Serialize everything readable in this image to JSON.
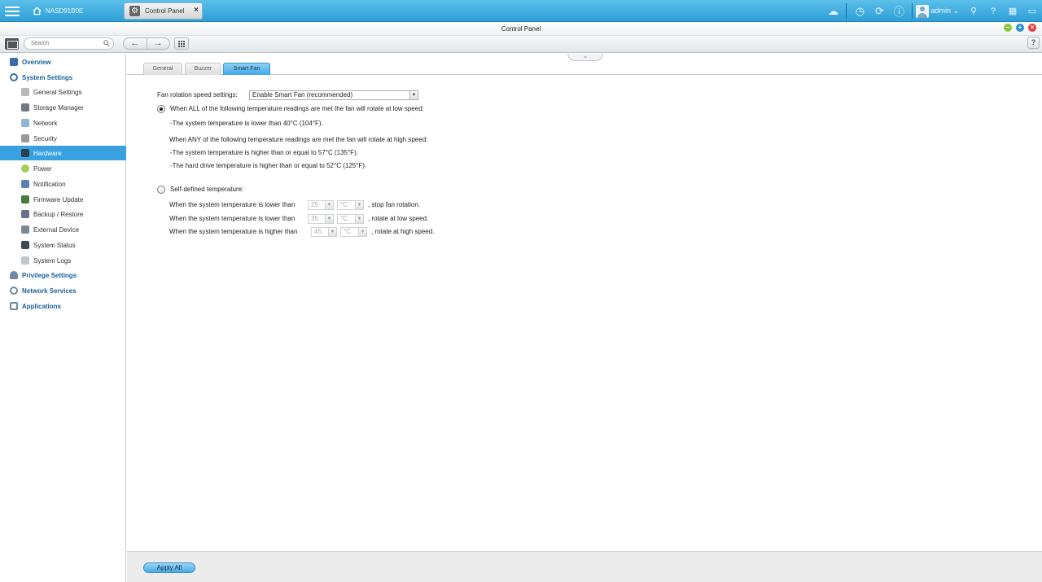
{
  "taskbar": {
    "nas_name": "NASD91B0E",
    "app_tab_label": "Control Panel",
    "user": "admin"
  },
  "window": {
    "title": "Control Panel"
  },
  "toolbar": {
    "search_placeholder": "Search",
    "back_label": "←",
    "forward_label": "→",
    "help_label": "?"
  },
  "sidebar": {
    "overview": "Overview",
    "system_settings": "System Settings",
    "items": [
      "General Settings",
      "Storage Manager",
      "Network",
      "Security",
      "Hardware",
      "Power",
      "Notification",
      "Firmware Update",
      "Backup / Restore",
      "External Device",
      "System Status",
      "System Logs"
    ],
    "active_index": 4,
    "privilege_settings": "Privilege Settings",
    "network_services": "Network Services",
    "applications": "Applications"
  },
  "tabs": [
    "General",
    "Buzzer",
    "Smart Fan"
  ],
  "smart_fan": {
    "speed_label": "Fan rotation speed settings:",
    "speed_value": "Enable Smart Fan (recommended)",
    "option_auto": "When ALL of the following temperature readings are met the fan will rotate at low speed:",
    "low_cond_1": "-The system temperature is lower than 40°C (104°F).",
    "high_intro": "When ANY of the following temperature readings are met the fan will rotate at high speed:",
    "high_cond_1": "-The system temperature is higher than or equal to 57°C (135°F).",
    "high_cond_2": "-The hard drive temperature is higher than or equal to 52°C (125°F).",
    "option_custom": "Self-defined temperature:",
    "custom_rows": [
      {
        "prefix": "When the system temperature is lower than",
        "value": "25",
        "unit": "°C",
        "suffix": ", stop fan rotation."
      },
      {
        "prefix": "When the system temperature is lower than",
        "value": "35",
        "unit": "°C",
        "suffix": ", rotate at low speed."
      },
      {
        "prefix": "When the system temperature is higher than",
        "value": "45",
        "unit": "°C",
        "suffix": ", rotate at high speed."
      }
    ]
  },
  "footer": {
    "apply_all": "Apply All"
  }
}
